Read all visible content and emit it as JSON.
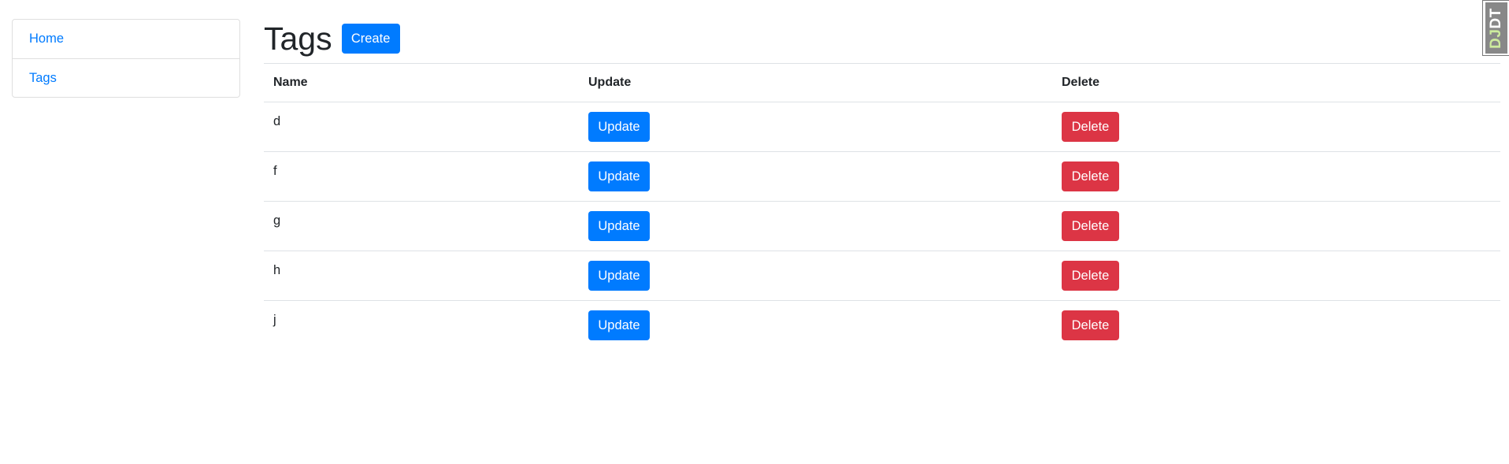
{
  "sidebar": {
    "items": [
      {
        "label": "Home"
      },
      {
        "label": "Tags"
      }
    ]
  },
  "header": {
    "title": "Tags",
    "create_label": "Create"
  },
  "table": {
    "columns": [
      "Name",
      "Update",
      "Delete"
    ],
    "rows": [
      {
        "name": "d",
        "update_label": "Update",
        "delete_label": "Delete"
      },
      {
        "name": "f",
        "update_label": "Update",
        "delete_label": "Delete"
      },
      {
        "name": "g",
        "update_label": "Update",
        "delete_label": "Delete"
      },
      {
        "name": "h",
        "update_label": "Update",
        "delete_label": "Delete"
      },
      {
        "name": "j",
        "update_label": "Update",
        "delete_label": "Delete"
      }
    ]
  },
  "debug_toolbar": {
    "label_prefix": "DJ",
    "label_suffix": "DT"
  },
  "colors": {
    "primary": "#007bff",
    "danger": "#dc3545",
    "border": "#dee2e6"
  }
}
